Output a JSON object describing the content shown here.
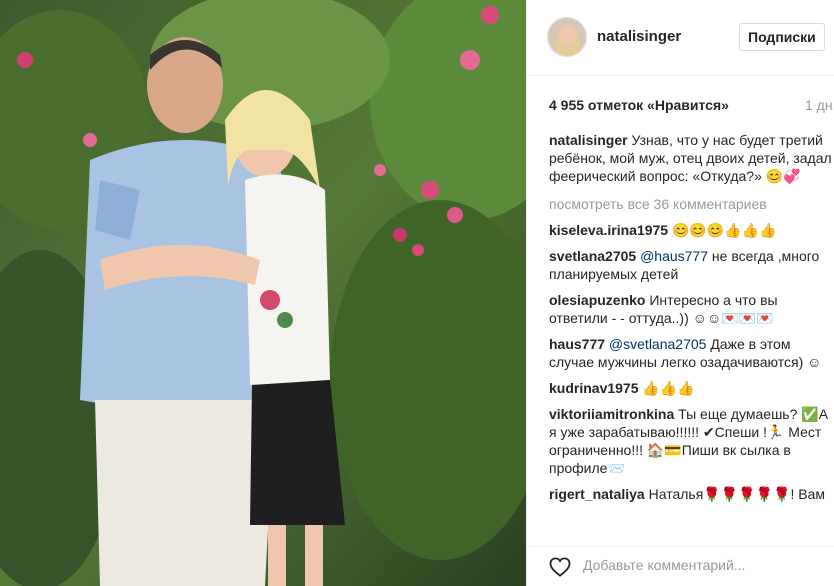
{
  "post": {
    "username": "natalisinger",
    "follow_label": "Подписки",
    "likes": "4 955 отметок «Нравится»",
    "age": "1 дн.",
    "caption_user": "natalisinger",
    "caption_text": " Узнав, что у нас будет третий ребёнок, мой муж, отец двоих детей, задал феерический вопрос: «Откуда?» 😊💞",
    "view_all": "посмотреть все 36 комментариев",
    "comments": [
      {
        "user": "kiseleva.irina1975",
        "mention": "",
        "text": " 😊😊😊👍👍👍"
      },
      {
        "user": "svetlana2705",
        "mention": " @haus777",
        "text": " не всегда ,много планируемых детей"
      },
      {
        "user": "olesiapuzenko",
        "mention": "",
        "text": " Интересно а что вы ответили - - оттуда..)) ☺☺💌💌💌"
      },
      {
        "user": "haus777",
        "mention": " @svetlana2705",
        "text": " Даже в этом случае мужчины легко озадачиваются) ☺"
      },
      {
        "user": "kudrinav1975",
        "mention": "",
        "text": " 👍👍👍"
      },
      {
        "user": "viktoriiamitronkina",
        "mention": "",
        "text": " Ты еще думаешь? ✅А я уже зарабатываю!!!!!! ✔Спеши !🏃 Мест ограниченно!!! 🏠💳Пиши вк сылка в профиле📨"
      },
      {
        "user": "rigert_nataliya",
        "mention": "",
        "text": " Наталья🌹🌹🌹🌹🌹! Вам"
      }
    ],
    "add_comment_placeholder": "Добавьте комментарий..."
  },
  "icons": {
    "like": "heart-icon"
  },
  "colors": {
    "border": "#efefef",
    "text": "#262626",
    "muted": "#999999",
    "mention": "#003569"
  }
}
